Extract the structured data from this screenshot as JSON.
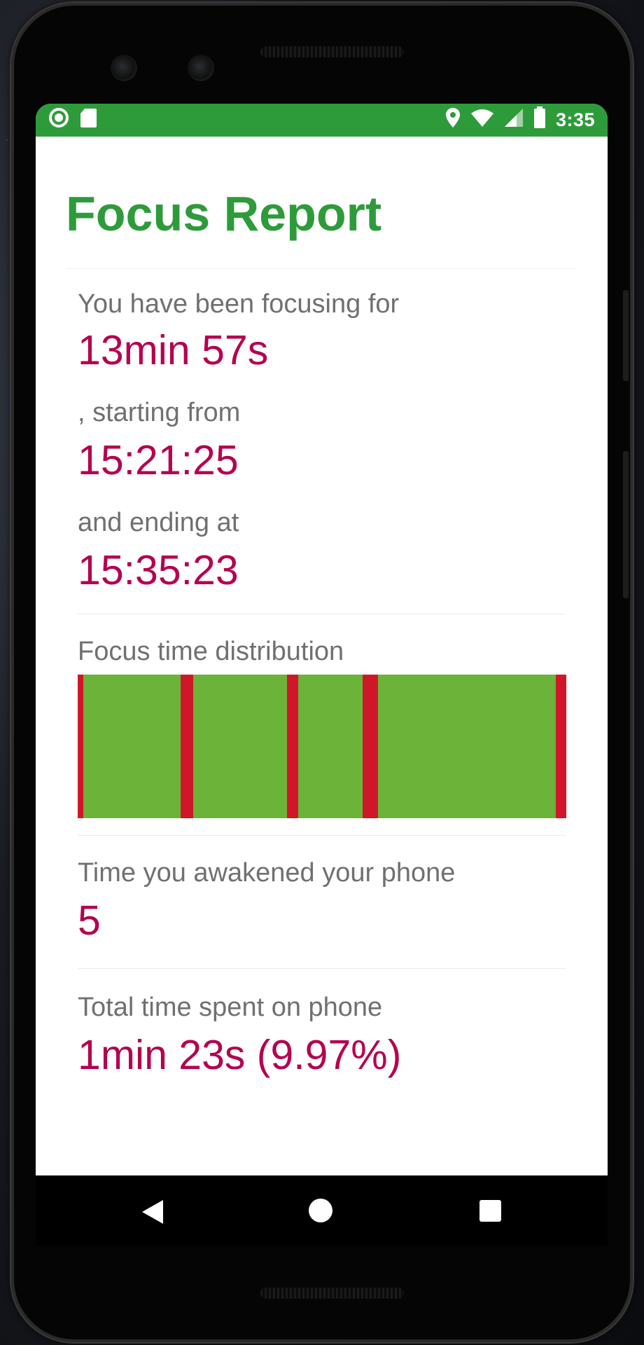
{
  "status_bar": {
    "time": "3:35",
    "icons": [
      "record-icon",
      "sd-card-icon",
      "location-icon",
      "wifi-icon",
      "signal-icon",
      "battery-icon"
    ]
  },
  "title": "Focus Report",
  "report": {
    "focusing_label": "You have been focusing for",
    "focusing_value": "13min 57s",
    "start_label": ", starting from",
    "start_value": "15:21:25",
    "end_label": "and ending at",
    "end_value": "15:35:23",
    "distribution_label": "Focus time distribution",
    "awakened_label": "Time you awakened your phone",
    "awakened_value": "5",
    "total_label": "Total time spent on phone",
    "total_value": "1min 23s  (9.97%)"
  },
  "distribution": {
    "colors": {
      "focus": "#6cb33a",
      "phone": "#d0172a"
    },
    "phone_use_segments": [
      {
        "start": 0.0,
        "end": 0.011
      },
      {
        "start": 0.211,
        "end": 0.237
      },
      {
        "start": 0.429,
        "end": 0.451
      },
      {
        "start": 0.583,
        "end": 0.614
      },
      {
        "start": 0.979,
        "end": 1.0
      }
    ]
  },
  "nav_bar": {
    "icons": [
      "back-icon",
      "home-icon",
      "recents-icon"
    ]
  },
  "colors": {
    "accent_green": "#2e9b3b",
    "value_magenta": "#b5004f",
    "label_gray": "#707070"
  }
}
